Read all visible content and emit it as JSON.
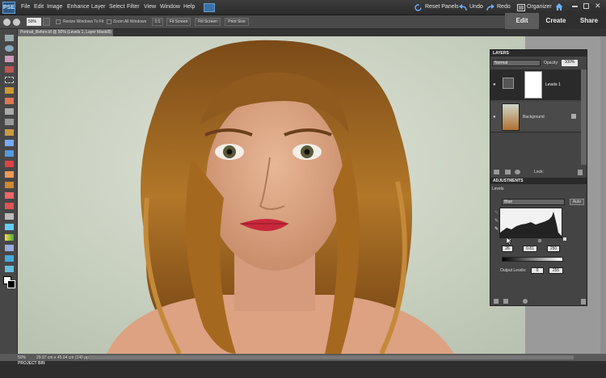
{
  "app": {
    "logo_text": "PSE"
  },
  "menu": [
    "File",
    "Edit",
    "Image",
    "Enhance",
    "Layer",
    "Select",
    "Filter",
    "View",
    "Window",
    "Help"
  ],
  "topbar": {
    "reset_panels": "Reset Panels",
    "undo": "Undo",
    "redo": "Redo",
    "organizer": "Organizer"
  },
  "modes": {
    "edit": "Edit",
    "create": "Create",
    "share": "Share"
  },
  "options": {
    "zoom_value": "50%",
    "resize_windows": "Resize Windows To Fit",
    "zoom_all": "Zoom All Windows",
    "btn_1_1": "1:1",
    "btn_fit": "Fit Screen",
    "btn_fill": "Fill Screen",
    "btn_print": "Print Size"
  },
  "document_tab": "Portrait_Before.tif @ 50% (Levels 1, Layer Mask/8) *",
  "layers_panel": {
    "title": "LAYERS",
    "blend_mode": "Normal",
    "opacity_label": "Opacity:",
    "opacity_value": "100%",
    "layers": [
      "Levels 1",
      "Background"
    ],
    "lock_label": "Lock:"
  },
  "adjustments_panel": {
    "title": "ADJUSTMENTS",
    "type": "Levels",
    "channel": "Blue",
    "auto_label": "Auto",
    "input_black": "26",
    "input_gamma": "0.81",
    "input_white": "250",
    "output_label": "Output Levels:",
    "output_black": "0",
    "output_white": "255"
  },
  "status": {
    "zoom": "50%",
    "doc_size": "29.97 cm x 45.04 cm (240 ppi)"
  },
  "project_bin": {
    "label": "PROJECT BIN"
  },
  "colors": {
    "accent": "#2f6fb0",
    "panel_bg": "#444444"
  }
}
